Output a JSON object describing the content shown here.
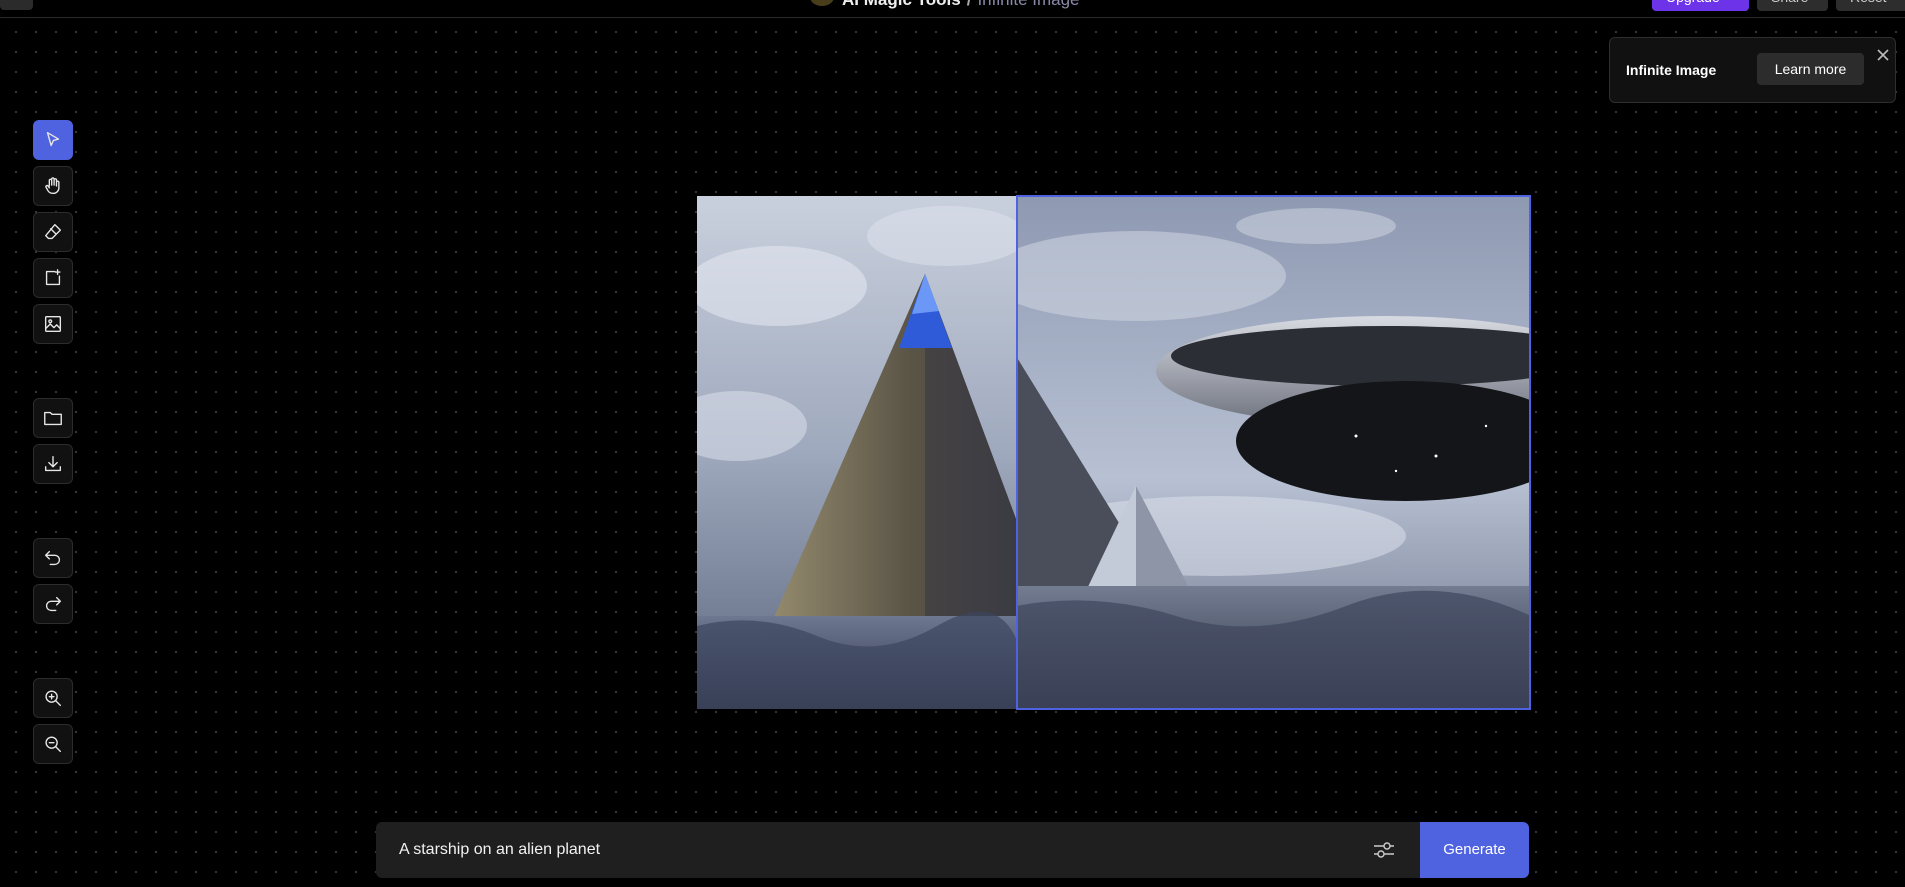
{
  "topbar": {
    "title": "AI Magic Tools",
    "separator": "/",
    "page": "Infinite Image",
    "upgrade_label": "Upgrade",
    "share_label": "Share",
    "reset_label": "Reset"
  },
  "toolbar": {
    "tools": [
      {
        "name": "select",
        "icon": "cursor-icon",
        "active": true
      },
      {
        "name": "pan",
        "icon": "hand-icon",
        "active": false
      },
      {
        "name": "erase",
        "icon": "eraser-icon",
        "active": false
      },
      {
        "name": "new-frame",
        "icon": "new-frame-icon",
        "active": false
      },
      {
        "name": "add-image",
        "icon": "image-icon",
        "active": false
      },
      {
        "name": "open",
        "icon": "folder-icon",
        "active": false
      },
      {
        "name": "download",
        "icon": "download-icon",
        "active": false
      },
      {
        "name": "undo",
        "icon": "undo-icon",
        "active": false
      },
      {
        "name": "redo",
        "icon": "redo-icon",
        "active": false
      },
      {
        "name": "zoom-in",
        "icon": "zoom-in-icon",
        "active": false
      },
      {
        "name": "zoom-out",
        "icon": "zoom-out-icon",
        "active": false
      }
    ]
  },
  "popup": {
    "title": "Infinite Image",
    "button_label": "Learn more"
  },
  "prompt": {
    "value": "A starship on an alien planet",
    "generate_label": "Generate"
  },
  "colors": {
    "accent": "#4f62e0",
    "upgrade": "#6d33e8",
    "background": "#000000",
    "panel": "#1f1f1f"
  }
}
